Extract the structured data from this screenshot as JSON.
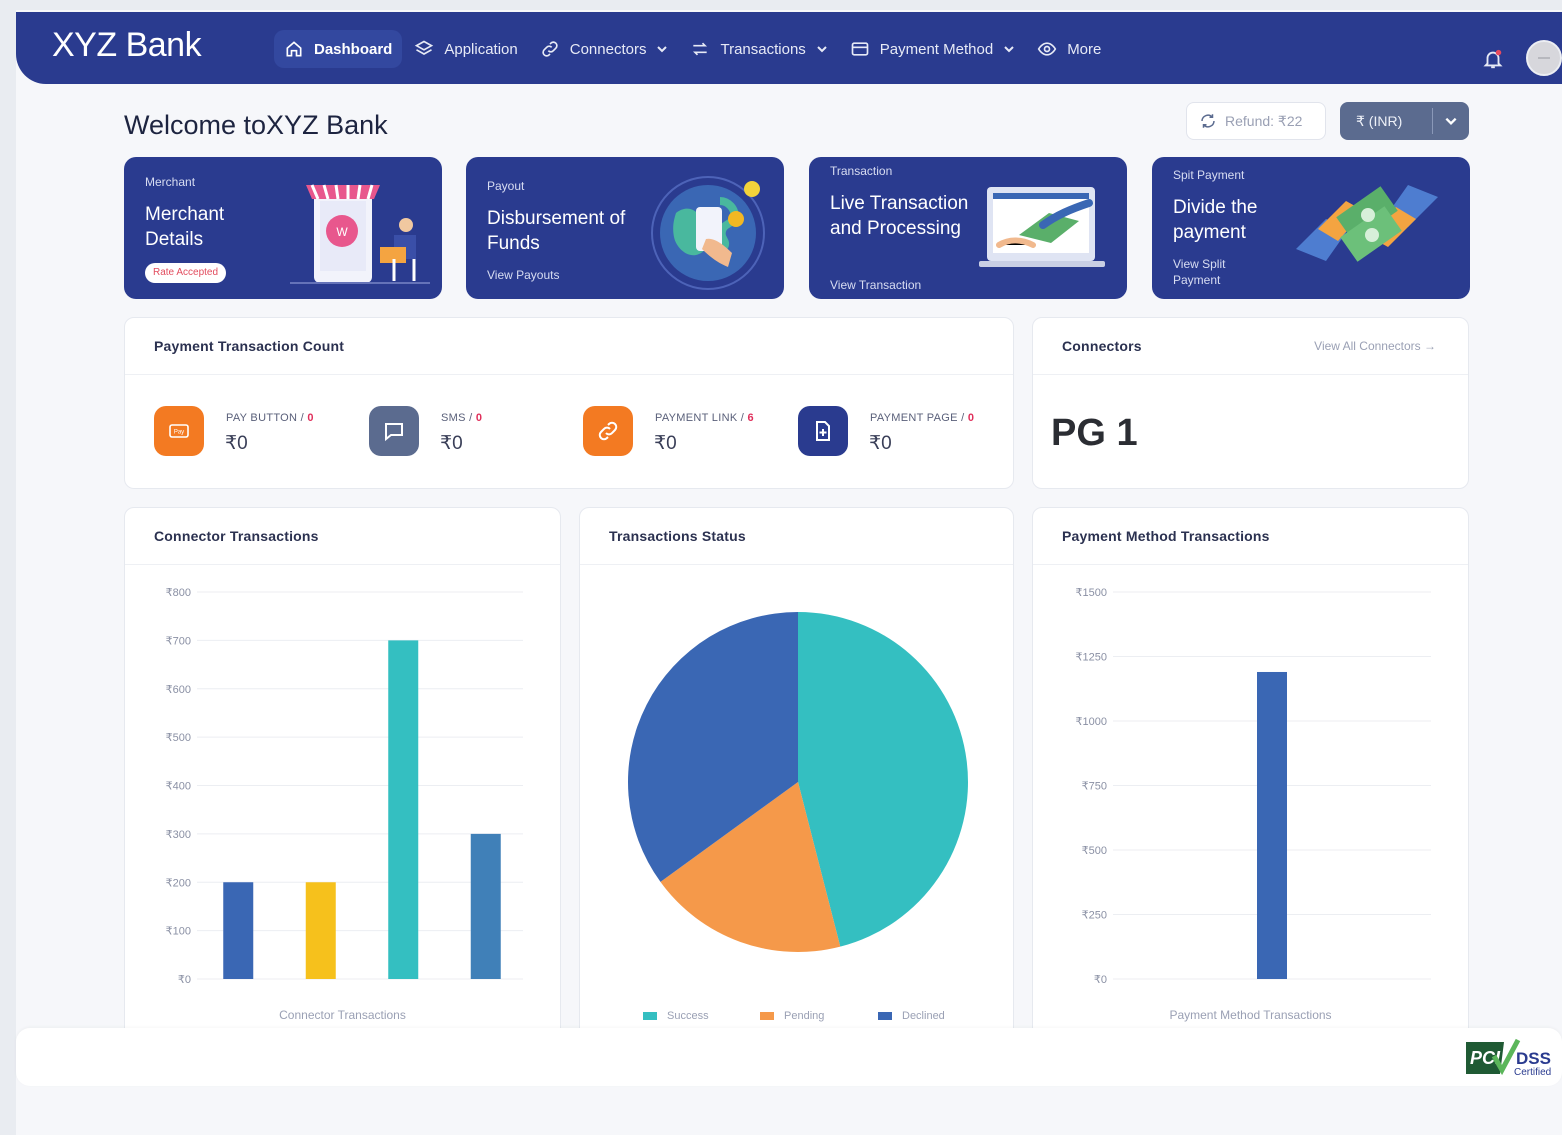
{
  "app": {
    "brand": "XYZ Bank"
  },
  "nav": {
    "items": [
      {
        "label": "Dashboard",
        "icon": "home-icon",
        "active": true
      },
      {
        "label": "Application",
        "icon": "layers-icon"
      },
      {
        "label": "Connectors",
        "icon": "link-icon",
        "dropdown": true
      },
      {
        "label": "Transactions",
        "icon": "swap-icon",
        "dropdown": true
      },
      {
        "label": "Payment Method",
        "icon": "card-icon",
        "dropdown": true
      },
      {
        "label": "More",
        "icon": "eye-icon"
      }
    ]
  },
  "header": {
    "welcome": "Welcome toXYZ Bank",
    "refund_label": "Refund: ₹22",
    "currency_label": "₹ (INR)"
  },
  "promos": [
    {
      "kicker": "Merchant",
      "title": "Merchant Details",
      "badge": "Rate Accepted"
    },
    {
      "kicker": "Payout",
      "title": "Disbursement of Funds",
      "link": "View Payouts"
    },
    {
      "kicker": "Transaction",
      "title": "Live Transaction and Processing",
      "link": "View Transaction"
    },
    {
      "kicker": "Spit Payment",
      "title": "Divide the payment",
      "link": "View Split Payment"
    }
  ],
  "payment_count": {
    "title": "Payment Transaction Count",
    "items": [
      {
        "label": "PAY BUTTON /",
        "count": "0",
        "value": "₹0",
        "icon": "pay-button-icon",
        "color": "#f37a22"
      },
      {
        "label": "SMS /",
        "count": "0",
        "value": "₹0",
        "icon": "chat-icon",
        "color": "#5b6b8f"
      },
      {
        "label": "PAYMENT LINK /",
        "count": "6",
        "value": "₹0",
        "icon": "link-icon",
        "color": "#f37a22"
      },
      {
        "label": "PAYMENT PAGE /",
        "count": "0",
        "value": "₹0",
        "icon": "page-add-icon",
        "color": "#2a3b8f"
      }
    ]
  },
  "connectors": {
    "title": "Connectors",
    "view_all": "View All Connectors →",
    "value": "PG 1"
  },
  "charts": {
    "connector": {
      "title": "Connector Transactions",
      "footer": "Connector Transactions"
    },
    "status": {
      "title": "Transactions Status"
    },
    "payment_method": {
      "title": "Payment Method Transactions",
      "footer": "Payment Method Transactions"
    }
  },
  "chart_data": [
    {
      "type": "bar",
      "title": "Connector Transactions",
      "xlabel": "Connector Transactions",
      "ylabel": "",
      "ylim": [
        0,
        800
      ],
      "yticks": [
        "₹0",
        "₹100",
        "₹200",
        "₹300",
        "₹400",
        "₹500",
        "₹600",
        "₹700",
        "₹800"
      ],
      "values": [
        200,
        200,
        700,
        300
      ],
      "colors": [
        "#3a67b4",
        "#f6c11c",
        "#34bfc1",
        "#4080b8"
      ],
      "grid": true
    },
    {
      "type": "pie",
      "title": "Transactions Status",
      "labels": [
        "Success",
        "Pending",
        "Declined"
      ],
      "values": [
        46,
        19,
        35
      ],
      "colors": [
        "#34bfc1",
        "#f5994a",
        "#3a67b4"
      ],
      "legend": "bottom"
    },
    {
      "type": "bar",
      "title": "Payment Method Transactions",
      "xlabel": "Payment Method Transactions",
      "ylabel": "",
      "ylim": [
        0,
        1500
      ],
      "yticks": [
        "₹0",
        "₹250",
        "₹500",
        "₹750",
        "₹1000",
        "₹1250",
        "₹1500"
      ],
      "values": [
        1190
      ],
      "colors": [
        "#3a67b4"
      ],
      "grid": true
    }
  ],
  "footer": {
    "cert_main": "PCI",
    "cert_dss": "DSS",
    "cert_sub": "Certified"
  }
}
